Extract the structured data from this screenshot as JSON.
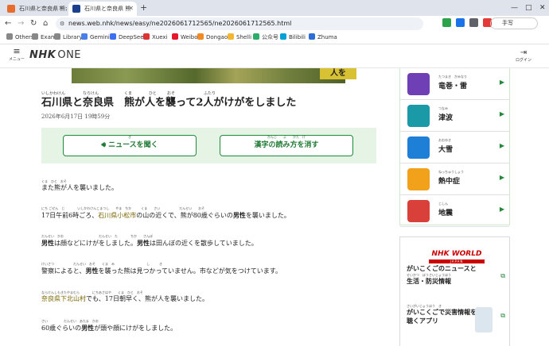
{
  "browser": {
    "tabs": [
      {
        "title": "石川県と奈良県 熊が人を",
        "active": false,
        "favicon_color": "#e86c2c"
      },
      {
        "title": "石川県と奈良県 熊",
        "active": true,
        "favicon_color": "#1b3f8c"
      }
    ],
    "new_tab": "+",
    "translate_label": "手写",
    "url": "news.web.nhk/news/easy/ne2026061712565/ne2026061712565.html",
    "bookmarks": [
      {
        "label": "Others",
        "color": "#888888"
      },
      {
        "label": "Exam",
        "color": "#888888"
      },
      {
        "label": "Library",
        "color": "#888888"
      },
      {
        "label": "Gemini",
        "color": "#4a7ee8"
      },
      {
        "label": "DeepSeek",
        "color": "#3d6ff2"
      },
      {
        "label": "Xuexi",
        "color": "#d33"
      },
      {
        "label": "Weibo",
        "color": "#e6162d"
      },
      {
        "label": "Dongao",
        "color": "#f08a24"
      },
      {
        "label": "Shelli",
        "color": "#f2b632"
      },
      {
        "label": "公众号",
        "color": "#2aae67"
      },
      {
        "label": "Bilibili",
        "color": "#00a1d6"
      },
      {
        "label": "Zhuma",
        "color": "#2b6fd6"
      }
    ]
  },
  "header": {
    "menu_label": "メニュー",
    "logo_main": "NHK",
    "logo_sub": "ONE",
    "login_label": "ログイン"
  },
  "hero": {
    "sign_text": "人を"
  },
  "article": {
    "title": "石川県と奈良県　熊が人を襲って2人がけがをしました",
    "title_ruby": [
      "いしかわけん",
      "ならけん",
      "くま",
      "ひと",
      "おそ",
      "ふたり"
    ],
    "date": "2026年6月17日 19時59分",
    "listen_button": "ニュースを聞く",
    "listen_ruby": "き",
    "hide_ruby_button": "漢字の読み方を消す",
    "hide_ruby_ruby": "かんじ　　よ　　かた　け",
    "paragraphs": [
      {
        "text": "また熊が人を襲いました。",
        "ruby": "くま　ひと　おそ"
      },
      {
        "text_parts": [
          "17日午前6時ごろ、",
          "石川県小松市",
          "の山の近くで、熊が80歳ぐらいの",
          "男性",
          "を襲いました。"
        ],
        "ruby": "にち ごぜん　じ　　　　いしかわけんこまつし　　やま　ちか　　　くま　　さい　　　　　　だんせい　　おそ"
      },
      {
        "text_parts": [
          "男性",
          "は顔などにけがをしました。",
          "男性",
          "は田んぼの近くを散歩していました。"
        ],
        "ruby": "だんせい　かお　　　　　　　　　　　だんせい　た　　　　ちか　　さんぽ"
      },
      {
        "text_parts": [
          "警察によると、",
          "男性",
          "を襲った熊は見つかっていません。市などが気をつけています。"
        ],
        "ruby": "けいさつ　　　　　　だんせい　おそ　　くま　み　　　　　　　　　　し　　　き"
      },
      {
        "text_parts": [
          "奈良県下北山村",
          "でも、17日朝早く、熊が人を襲いました。"
        ],
        "ruby": "ならけんしもきたやまむら　　　　にちあさはや　　くま　ひと　おそ"
      },
      {
        "text_parts": [
          "60歳ぐらいの",
          "男性",
          "が頭や顔にけがをしました。"
        ],
        "ruby": "さい　　　　　だんせい　あたま　かお"
      }
    ]
  },
  "disaster_links": [
    {
      "label": "竜巻・雷",
      "ruby": "たつまき　かみなり",
      "icon": "tornado-icon",
      "color": "#6f3fb5"
    },
    {
      "label": "津波",
      "ruby": "つなみ",
      "icon": "tsunami-icon",
      "color": "#1a9aa6"
    },
    {
      "label": "大雪",
      "ruby": "おおゆき",
      "icon": "snowman-icon",
      "color": "#1e7fd6"
    },
    {
      "label": "熱中症",
      "ruby": "ねっちゅうしょう",
      "icon": "sun-icon",
      "color": "#f2a11a"
    },
    {
      "label": "地震",
      "ruby": "じしん",
      "icon": "house-quake-icon",
      "color": "#d9403a"
    }
  ],
  "nhk_world": {
    "logo": "NHK WORLD",
    "logo_sub": "JAPAN",
    "items": [
      {
        "text_lines": [
          "がいこくごのニュースと",
          "生活・防災情報"
        ],
        "ruby": "せいかつ　ぼうさいじょうほう"
      },
      {
        "text_lines": [
          "がいこくごで災害情報を",
          "聴くアプリ"
        ],
        "ruby": "さいがいじょうほう　き"
      }
    ]
  }
}
